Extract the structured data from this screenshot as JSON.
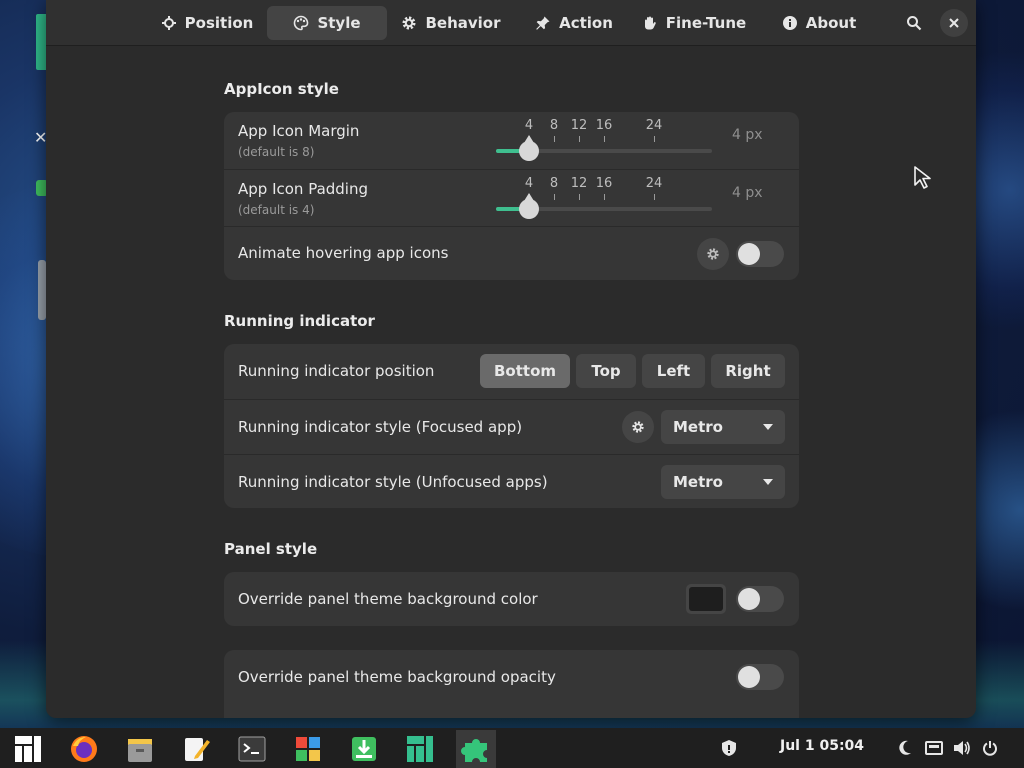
{
  "tabs": [
    {
      "label": "Position",
      "icon": "crosshair-icon"
    },
    {
      "label": "Style",
      "icon": "palette-icon"
    },
    {
      "label": "Behavior",
      "icon": "gear-icon"
    },
    {
      "label": "Action",
      "icon": "pin-icon"
    },
    {
      "label": "Fine-Tune",
      "icon": "hand-icon"
    },
    {
      "label": "About",
      "icon": "info-icon"
    }
  ],
  "active_tab": "Style",
  "header": {
    "search_icon": "search-icon",
    "close_icon": "close-icon"
  },
  "sections": {
    "appicon": {
      "title": "AppIcon style",
      "margin": {
        "title": "App Icon Margin",
        "subtitle": "(default is 8)",
        "value": 4,
        "value_label": "4 px"
      },
      "padding": {
        "title": "App Icon Padding",
        "subtitle": "(default is 4)",
        "value": 4,
        "value_label": "4 px"
      },
      "scale_marks": [
        "4",
        "8",
        "12",
        "16",
        "24"
      ],
      "scale_range": [
        0,
        32
      ],
      "hover": {
        "title": "Animate hovering app icons",
        "enabled": false
      }
    },
    "running": {
      "title": "Running indicator",
      "position": {
        "title": "Running indicator position",
        "options": [
          "Bottom",
          "Top",
          "Left",
          "Right"
        ],
        "selected": "Bottom"
      },
      "focused": {
        "title": "Running indicator style (Focused app)",
        "value": "Metro"
      },
      "unfocused": {
        "title": "Running indicator style (Unfocused apps)",
        "value": "Metro"
      }
    },
    "panel": {
      "title": "Panel style",
      "bg_color": {
        "title": "Override panel theme background color",
        "color": "#1e1e1e",
        "enabled": false
      },
      "bg_opacity": {
        "title": "Override panel theme background opacity",
        "enabled": false
      }
    }
  },
  "colors": {
    "accent": "#3fbf8f",
    "window_bg": "#2b2b2b",
    "card_bg": "#363636"
  },
  "taskbar": {
    "apps": [
      "manjaro-menu-icon",
      "firefox-icon",
      "file-manager-icon",
      "text-editor-icon",
      "terminal-icon",
      "software-store-icon",
      "package-installer-icon",
      "manjaro-settings-icon",
      "extensions-icon"
    ],
    "active_app": "extensions-icon",
    "clock": "Jul 1  05:04",
    "tray": [
      "shield-icon",
      "night-mode-icon",
      "network-icon",
      "volume-icon",
      "power-icon"
    ]
  }
}
